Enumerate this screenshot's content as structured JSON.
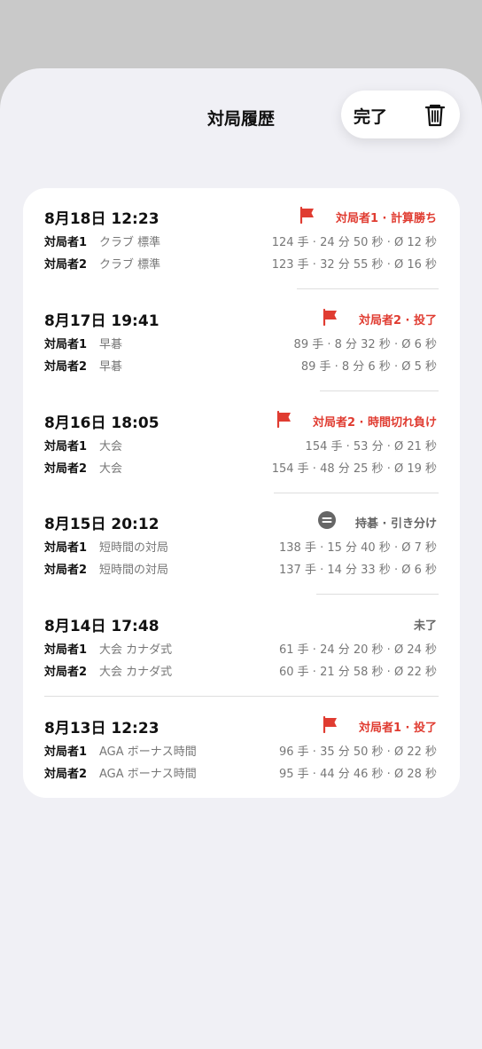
{
  "header": {
    "title": "対局履歴",
    "done_label": "完了",
    "trash_icon": "trash-icon"
  },
  "colors": {
    "accent_red": "#e03c31",
    "sheet_bg": "#f0f0f5",
    "card_bg": "#ffffff"
  },
  "games": [
    {
      "date": "8月18日 12:23",
      "result": "対局者1 · 計算勝ち",
      "result_icon": "flag-icon",
      "result_color": "red",
      "players": [
        {
          "name": "対局者1",
          "mode": "クラブ 標準",
          "stats": "124 手 · 24 分 50 秒 · Ø 12 秒"
        },
        {
          "name": "対局者2",
          "mode": "クラブ 標準",
          "stats": "123 手 · 32 分 55 秒 · Ø 16 秒"
        }
      ]
    },
    {
      "date": "8月17日 19:41",
      "result": "対局者2 · 投了",
      "result_icon": "flag-icon",
      "result_color": "red",
      "players": [
        {
          "name": "対局者1",
          "mode": "早碁",
          "stats": "89 手 · 8 分 32 秒 · Ø 6 秒"
        },
        {
          "name": "対局者2",
          "mode": "早碁",
          "stats": "89 手 · 8 分 6 秒 · Ø 5 秒"
        }
      ]
    },
    {
      "date": "8月16日 18:05",
      "result": "対局者2 · 時間切れ負け",
      "result_icon": "flag-icon",
      "result_color": "red",
      "players": [
        {
          "name": "対局者1",
          "mode": "大会",
          "stats": "154 手 · 53 分 · Ø 21 秒"
        },
        {
          "name": "対局者2",
          "mode": "大会",
          "stats": "154 手 · 48 分 25 秒 · Ø 19 秒"
        }
      ]
    },
    {
      "date": "8月15日 20:12",
      "result": "持碁 · 引き分け",
      "result_icon": "equals-circle-icon",
      "result_color": "gray",
      "players": [
        {
          "name": "対局者1",
          "mode": "短時間の対局",
          "stats": "138 手 · 15 分 40 秒 · Ø 7 秒"
        },
        {
          "name": "対局者2",
          "mode": "短時間の対局",
          "stats": "137 手 · 14 分 33 秒 · Ø 6 秒"
        }
      ]
    },
    {
      "date": "8月14日 17:48",
      "result": "未了",
      "result_icon": "",
      "result_color": "gray",
      "players": [
        {
          "name": "対局者1",
          "mode": "大会 カナダ式",
          "stats": "61 手 · 24 分 20 秒 · Ø 24 秒"
        },
        {
          "name": "対局者2",
          "mode": "大会 カナダ式",
          "stats": "60 手 · 21 分 58 秒 · Ø 22 秒"
        }
      ]
    },
    {
      "date": "8月13日 12:23",
      "result": "対局者1 · 投了",
      "result_icon": "flag-icon",
      "result_color": "red",
      "players": [
        {
          "name": "対局者1",
          "mode": "AGA ボーナス時間",
          "stats": "96 手 · 35 分 50 秒 · Ø 22 秒"
        },
        {
          "name": "対局者2",
          "mode": "AGA ボーナス時間",
          "stats": "95 手 · 44 分 46 秒 · Ø 28 秒"
        }
      ]
    }
  ]
}
